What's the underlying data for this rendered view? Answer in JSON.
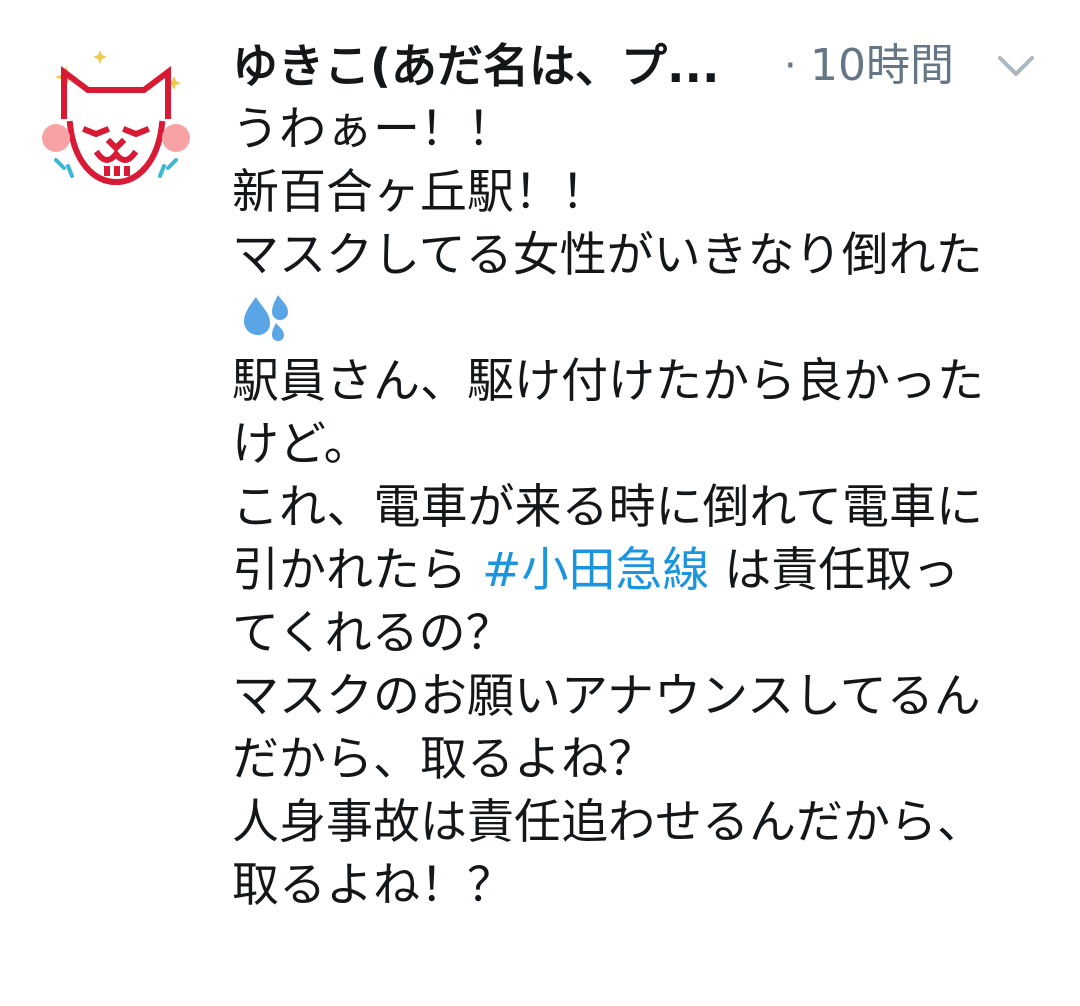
{
  "tweet": {
    "display_name": "ゆきこ(あだ名は、プ...",
    "separator": "·",
    "timestamp": "10時間",
    "caret_icon": "chevron-down-icon",
    "avatar_icon": "cat-face-icon",
    "colors": {
      "text": "#14171a",
      "meta": "#657786",
      "hashtag": "#1b95e0",
      "avatar_red": "#d91a35",
      "avatar_cheek": "#f7a3a5",
      "avatar_accent": "#3cb8d6",
      "sparkle": "#f2c94c",
      "emoji_drops": "#5aa5e6"
    },
    "lines": {
      "l1": "うわぁー！！",
      "l2": "新百合ヶ丘駅！！",
      "l3": "マスクしてる女性がいきなり倒れた",
      "l4_emoji": "sweat-droplets-icon",
      "l5": "駅員さん、駆け付けたから良かった",
      "l6": "けど。",
      "l7": "これ、電車が来る時に倒れて電車に",
      "l8_pre": "引かれたら ",
      "l8_hashtag": "#小田急線",
      "l8_post": " は責任取っ",
      "l9": "てくれるの？",
      "l10": "マスクのお願いアナウンスしてるん",
      "l11": "だから、取るよね？",
      "l12": "人身事故は責任追わせるんだから、",
      "l13": "取るよね！？"
    }
  }
}
